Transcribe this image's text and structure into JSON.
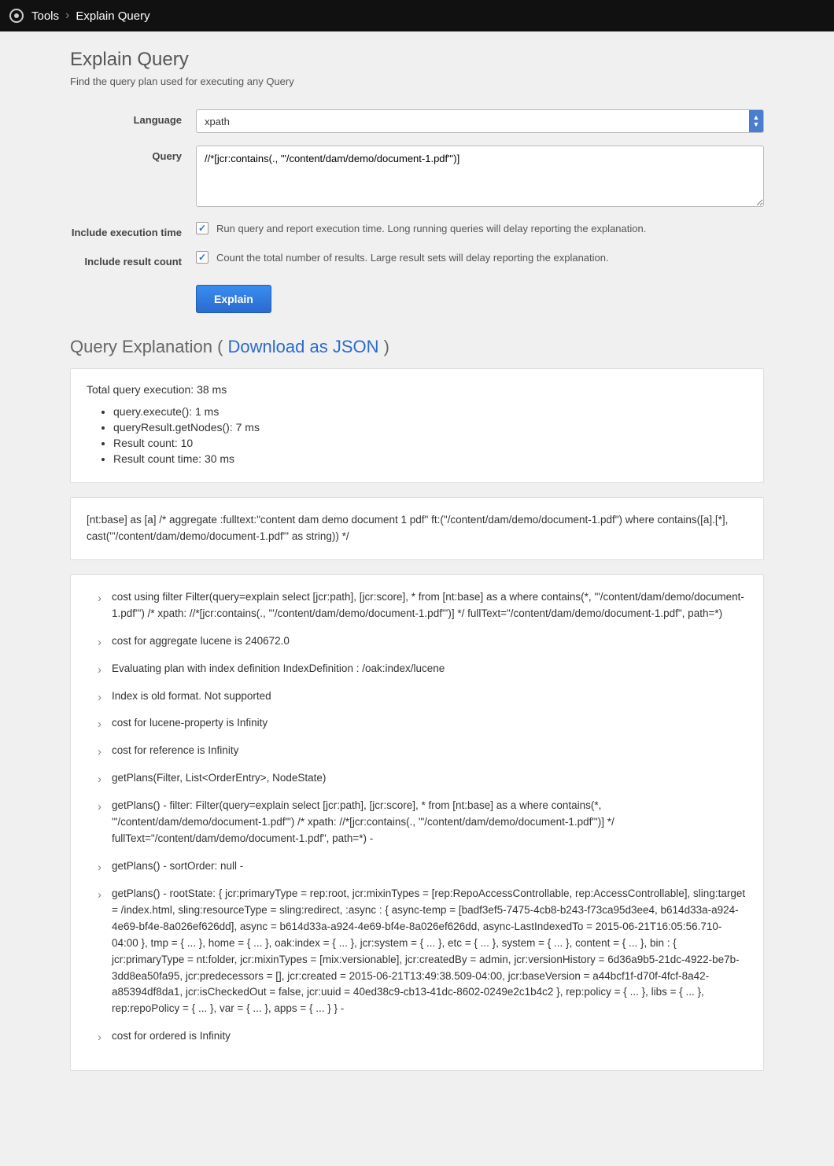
{
  "breadcrumb": {
    "root": "Tools",
    "current": "Explain Query"
  },
  "page": {
    "title": "Explain Query",
    "subtitle": "Find the query plan used for executing any Query"
  },
  "form": {
    "language_label": "Language",
    "language_value": "xpath",
    "query_label": "Query",
    "query_value": "//*[jcr:contains(., '\"/content/dam/demo/document-1.pdf\"')]",
    "include_time_label": "Include execution time",
    "include_time_desc": "Run query and report execution time. Long running queries will delay reporting the explanation.",
    "include_count_label": "Include result count",
    "include_count_desc": "Count the total number of results. Large result sets will delay reporting the explanation.",
    "explain_button": "Explain"
  },
  "results": {
    "heading_prefix": "Query Explanation ( ",
    "heading_link": "Download as JSON",
    "heading_suffix": " )",
    "total_line": "Total query execution: 38 ms",
    "timings": [
      "query.execute(): 1 ms",
      "queryResult.getNodes(): 7 ms",
      "Result count: 10",
      "Result count time: 30 ms"
    ],
    "plan": "[nt:base] as [a] /* aggregate :fulltext:\"content dam demo document 1 pdf\" ft:(\"/content/dam/demo/document-1.pdf\") where contains([a].[*], cast('\"/content/dam/demo/document-1.pdf\"' as string)) */",
    "logs": [
      "cost using filter Filter(query=explain select [jcr:path], [jcr:score], * from [nt:base] as a where contains(*, '\"/content/dam/demo/document-1.pdf\"') /* xpath: //*[jcr:contains(., '\"/content/dam/demo/document-1.pdf\"')] */ fullText=\"/content/dam/demo/document-1.pdf\", path=*)",
      "cost for aggregate lucene is 240672.0",
      "Evaluating plan with index definition IndexDefinition : /oak:index/lucene",
      "Index is old format. Not supported",
      "cost for lucene-property is Infinity",
      "cost for reference is Infinity",
      "getPlans(Filter, List<OrderEntry>, NodeState)",
      "getPlans() - filter: Filter(query=explain select [jcr:path], [jcr:score], * from [nt:base] as a where contains(*, '\"/content/dam/demo/document-1.pdf\"') /* xpath: //*[jcr:contains(., '\"/content/dam/demo/document-1.pdf\"')] */ fullText=\"/content/dam/demo/document-1.pdf\", path=*) -",
      "getPlans() - sortOrder: null -",
      "getPlans() - rootState: { jcr:primaryType = rep:root, jcr:mixinTypes = [rep:RepoAccessControllable, rep:AccessControllable], sling:target = /index.html, sling:resourceType = sling:redirect, :async : { async-temp = [badf3ef5-7475-4cb8-b243-f73ca95d3ee4, b614d33a-a924-4e69-bf4e-8a026ef626dd], async = b614d33a-a924-4e69-bf4e-8a026ef626dd, async-LastIndexedTo = 2015-06-21T16:05:56.710-04:00 }, tmp = { ... }, home = { ... }, oak:index = { ... }, jcr:system = { ... }, etc = { ... }, system = { ... }, content = { ... }, bin : { jcr:primaryType = nt:folder, jcr:mixinTypes = [mix:versionable], jcr:createdBy = admin, jcr:versionHistory = 6d36a9b5-21dc-4922-be7b-3dd8ea50fa95, jcr:predecessors = [], jcr:created = 2015-06-21T13:49:38.509-04:00, jcr:baseVersion = a44bcf1f-d70f-4fcf-8a42-a85394df8da1, jcr:isCheckedOut = false, jcr:uuid = 40ed38c9-cb13-41dc-8602-0249e2c1b4c2 }, rep:policy = { ... }, libs = { ... }, rep:repoPolicy = { ... }, var = { ... }, apps = { ... } } -",
      "cost for ordered is Infinity"
    ]
  }
}
